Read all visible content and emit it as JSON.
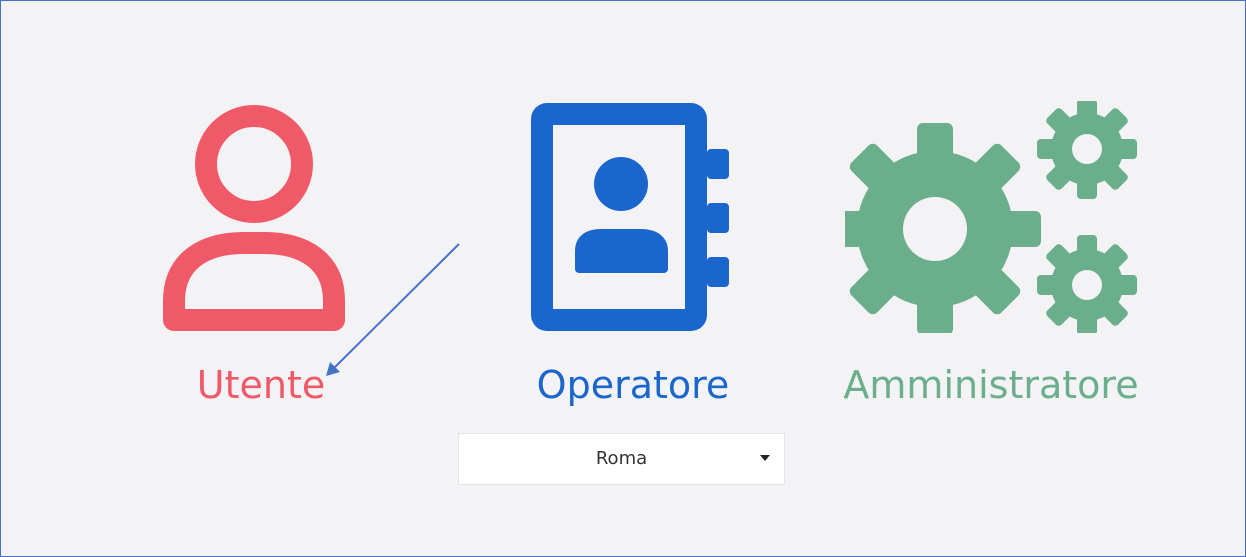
{
  "roles": {
    "utente": {
      "label": "Utente",
      "icon": "user-icon",
      "color": "#ef5968"
    },
    "operatore": {
      "label": "Operatore",
      "icon": "contact-book-icon",
      "color": "#1a66cc"
    },
    "amministratore": {
      "label": "Amministratore",
      "icon": "gears-icon",
      "color": "#6aae8c"
    }
  },
  "city_select": {
    "value": "Roma",
    "icon": "caret-down-icon"
  },
  "annotation": {
    "icon": "arrow-icon",
    "color": "#4472c4"
  },
  "frame_border_color": "#4472c4"
}
